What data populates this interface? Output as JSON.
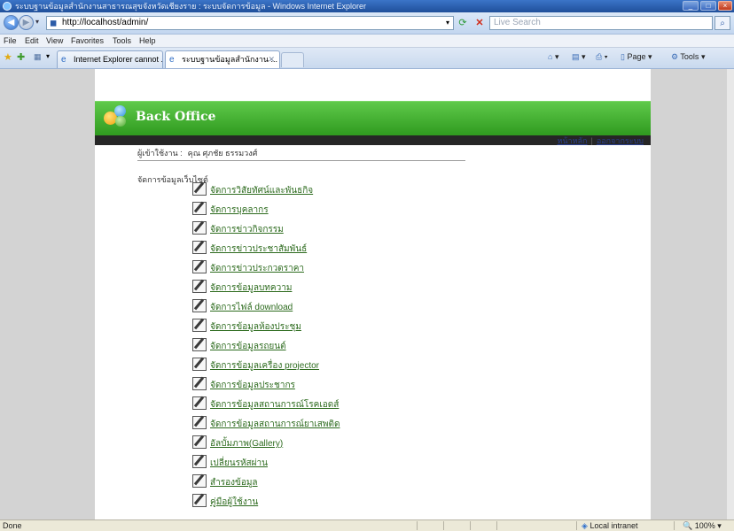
{
  "window": {
    "title": "ระบบฐานข้อมูลสำนักงานสาธารณสุขจังหวัดเชียงราย : ระบบจัดการข้อมูล - Windows Internet Explorer",
    "buttons": {
      "minimize": "_",
      "maximize": "□",
      "close": "×"
    }
  },
  "address": {
    "url": "http://localhost/admin/",
    "search_placeholder": "Live Search"
  },
  "menubar": [
    "File",
    "Edit",
    "View",
    "Favorites",
    "Tools",
    "Help"
  ],
  "tabs": [
    {
      "label": "Internet Explorer cannot ..."
    },
    {
      "label": "ระบบฐานข้อมูลสำนักงาน ..."
    }
  ],
  "commandbar": {
    "page": "Page",
    "tools": "Tools"
  },
  "page": {
    "banner_title": "Back Office",
    "nav_links": [
      "หน้าหลัก",
      "ออกจากระบบ"
    ],
    "user_label": "ผู้เข้าใช้งาน :",
    "user_name": "คุณ ศุภชัย ธรรมวงศ์",
    "section_title": "จัดการข้อมูลเว็บไซต์",
    "menu_items": [
      "จัดการวิสัยทัศน์และพันธกิจ",
      "จัดการบุคลากร",
      "จัดการข่าวกิจกรรม",
      "จัดการข่าวประชาสัมพันธ์",
      "จัดการข่าวประกวดราคา",
      "จัดการข้อมูลบทความ",
      "จัดการไฟล์ download",
      "จัดการข้อมูลห้องประชุม",
      "จัดการข้อมูลรถยนต์",
      "จัดการข้อมูลเครื่อง projector",
      "จัดการข้อมูลประชากร",
      "จัดการข้อมูลสถานการณ์โรคเอดส์",
      "จัดการข้อมูลสถานการณ์ยาเสพติด",
      "อัลบั้มภาพ(Gallery)",
      "เปลี่ยนรหัสผ่าน",
      "สำรองข้อมูล",
      "คู่มือผู้ใช้งาน"
    ]
  },
  "status": {
    "text": "Done",
    "zone": "Local intranet",
    "zoom": "100%"
  }
}
